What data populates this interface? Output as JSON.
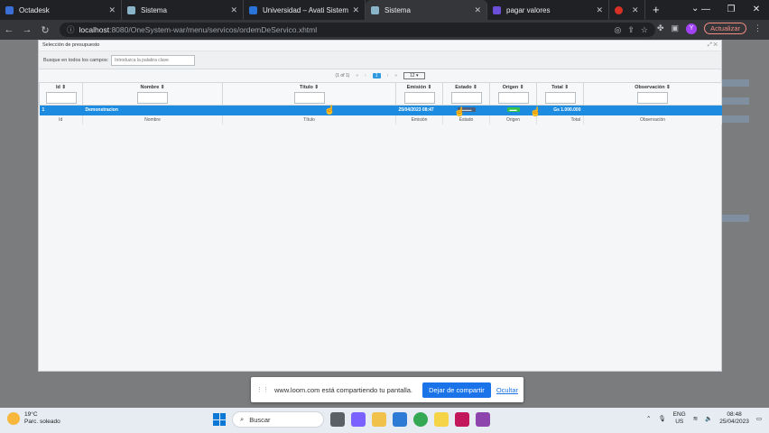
{
  "browser": {
    "tabs": [
      {
        "title": "Octadesk",
        "color": "#3b6fd6"
      },
      {
        "title": "Sistema",
        "color": "#8ab4c8"
      },
      {
        "title": "Universidad – Avati Sistemas",
        "color": "#2a73d9"
      },
      {
        "title": "Sistema",
        "color": "#8ab4c8"
      },
      {
        "title": "pagar valores",
        "color": "#6b4fd8"
      },
      {
        "title": "",
        "color": "#d93025"
      }
    ],
    "url_host": "localhost",
    "url_path": ":8080/OneSystem-war/menu/servicos/ordemDeServico.xhtml",
    "update_label": "Actualizar",
    "avatar_letter": "Y"
  },
  "dialog": {
    "title": "Selección de presupuesto",
    "search_label": "Busque en todos los campos:",
    "search_placeholder": "Introduzca la palabra clave",
    "paginator": {
      "status": "(1 of 1)",
      "first": "«",
      "prev": "‹",
      "current": "1",
      "next": "›",
      "last": "»",
      "rows": "12"
    },
    "columns": [
      {
        "label": "Id ⇕",
        "footer": "Id"
      },
      {
        "label": "Nombre ⇕",
        "footer": "Nombre"
      },
      {
        "label": "Título ⇕",
        "footer": "Título"
      },
      {
        "label": "Emisión ⇕",
        "footer": "Emisión"
      },
      {
        "label": "Estado ⇕",
        "footer": "Estado"
      },
      {
        "label": "Origen ⇕",
        "footer": "Origen"
      },
      {
        "label": "Total ⇕",
        "footer": "Total"
      },
      {
        "label": "Observación ⇕",
        "footer": "Observación"
      }
    ],
    "row": {
      "id": "1",
      "nombre": "Demonstracion",
      "titulo": "",
      "emision": "25/04/2023 08:47",
      "estado": "▬▬▬",
      "origen": "▬▬",
      "total": "Gs 1.000.000",
      "observacion": ""
    }
  },
  "sharebar": {
    "message": "www.loom.com está compartiendo tu pantalla.",
    "stop_label": "Dejar de compartir",
    "hide_label": "Ocultar"
  },
  "taskbar": {
    "temperature": "19°C",
    "condition": "Parc. soleado",
    "search_label": "Buscar",
    "lang_line1": "ENG",
    "lang_line2": "US",
    "time": "08:48",
    "date": "25/04/2023"
  }
}
